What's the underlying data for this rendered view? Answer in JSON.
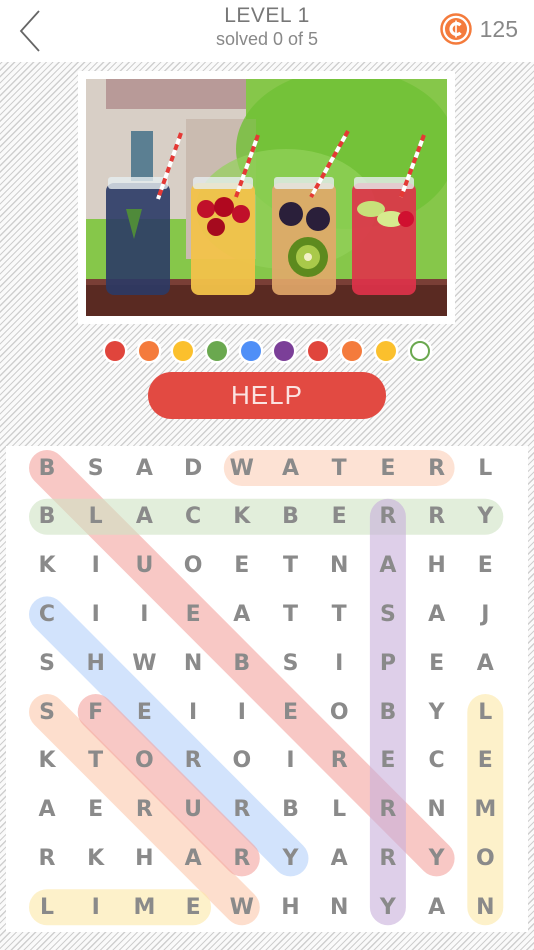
{
  "header": {
    "back_icon": "chevron-left-icon",
    "title": "LEVEL 1",
    "subtitle": "solved 0 of 5",
    "coin_icon": "coin-icon",
    "coins": "125",
    "coin_color": "#f47b3c"
  },
  "photo": {
    "description": "Four mason jars of fruit-infused water with red-and-white striped straws: blueberries with mint, cherries with orange slices, blackberries with kiwi, raspberries with lime"
  },
  "progress_dots": [
    {
      "color": "#e0453c",
      "filled": true
    },
    {
      "color": "#f47b3c",
      "filled": true
    },
    {
      "color": "#fbc02d",
      "filled": true
    },
    {
      "color": "#6aa84f",
      "filled": true
    },
    {
      "color": "#4f8ff7",
      "filled": true
    },
    {
      "color": "#7b3f98",
      "filled": true
    },
    {
      "color": "#e0453c",
      "filled": true
    },
    {
      "color": "#f47b3c",
      "filled": true
    },
    {
      "color": "#fbc02d",
      "filled": true
    },
    {
      "color": "#6aa84f",
      "filled": false
    }
  ],
  "help_button": {
    "label": "HELP",
    "color": "#e24a42"
  },
  "grid": {
    "rows": [
      [
        "B",
        "S",
        "A",
        "D",
        "W",
        "A",
        "T",
        "E",
        "R",
        "L"
      ],
      [
        "B",
        "L",
        "A",
        "C",
        "K",
        "B",
        "E",
        "R",
        "R",
        "Y"
      ],
      [
        "K",
        "I",
        "U",
        "O",
        "E",
        "T",
        "N",
        "A",
        "H",
        "E"
      ],
      [
        "C",
        "I",
        "I",
        "E",
        "A",
        "T",
        "T",
        "S",
        "A",
        "J"
      ],
      [
        "S",
        "H",
        "W",
        "N",
        "B",
        "S",
        "I",
        "P",
        "E",
        "A"
      ],
      [
        "S",
        "F",
        "E",
        "I",
        "I",
        "E",
        "O",
        "B",
        "Y",
        "L"
      ],
      [
        "K",
        "T",
        "O",
        "R",
        "O",
        "I",
        "R",
        "E",
        "C",
        "E"
      ],
      [
        "A",
        "E",
        "R",
        "U",
        "R",
        "B",
        "L",
        "R",
        "N",
        "M"
      ],
      [
        "R",
        "K",
        "H",
        "A",
        "R",
        "Y",
        "A",
        "R",
        "Y",
        "O"
      ],
      [
        "L",
        "I",
        "M",
        "E",
        "W",
        "H",
        "N",
        "Y",
        "A",
        "N"
      ]
    ],
    "highlights": [
      {
        "word": "BLUEBERRY",
        "from": [
          0,
          0
        ],
        "to": [
          8,
          8
        ],
        "color": "#f4a4a0"
      },
      {
        "word": "WATER",
        "from": [
          0,
          4
        ],
        "to": [
          0,
          8
        ],
        "color": "#fdd0b8"
      },
      {
        "word": "BLACKBERRY",
        "from": [
          1,
          0
        ],
        "to": [
          1,
          9
        ],
        "color": "#cfe4c4"
      },
      {
        "word": "RASPBERRY",
        "from": [
          1,
          7
        ],
        "to": [
          9,
          7
        ],
        "color": "#c9b0dc"
      },
      {
        "word": "CHERRY",
        "from": [
          3,
          0
        ],
        "to": [
          8,
          5
        ],
        "color": "#b5d1fb"
      },
      {
        "word": "STRAW",
        "from": [
          5,
          0
        ],
        "to": [
          9,
          4
        ],
        "color": "#fcc9ad"
      },
      {
        "word": "FOUR",
        "from": [
          5,
          1
        ],
        "to": [
          8,
          4
        ],
        "color": "#f4a4a0"
      },
      {
        "word": "LEMON",
        "from": [
          5,
          9
        ],
        "to": [
          9,
          9
        ],
        "color": "#fde8a8"
      },
      {
        "word": "LIME",
        "from": [
          9,
          0
        ],
        "to": [
          9,
          3
        ],
        "color": "#fde8a8"
      }
    ]
  }
}
